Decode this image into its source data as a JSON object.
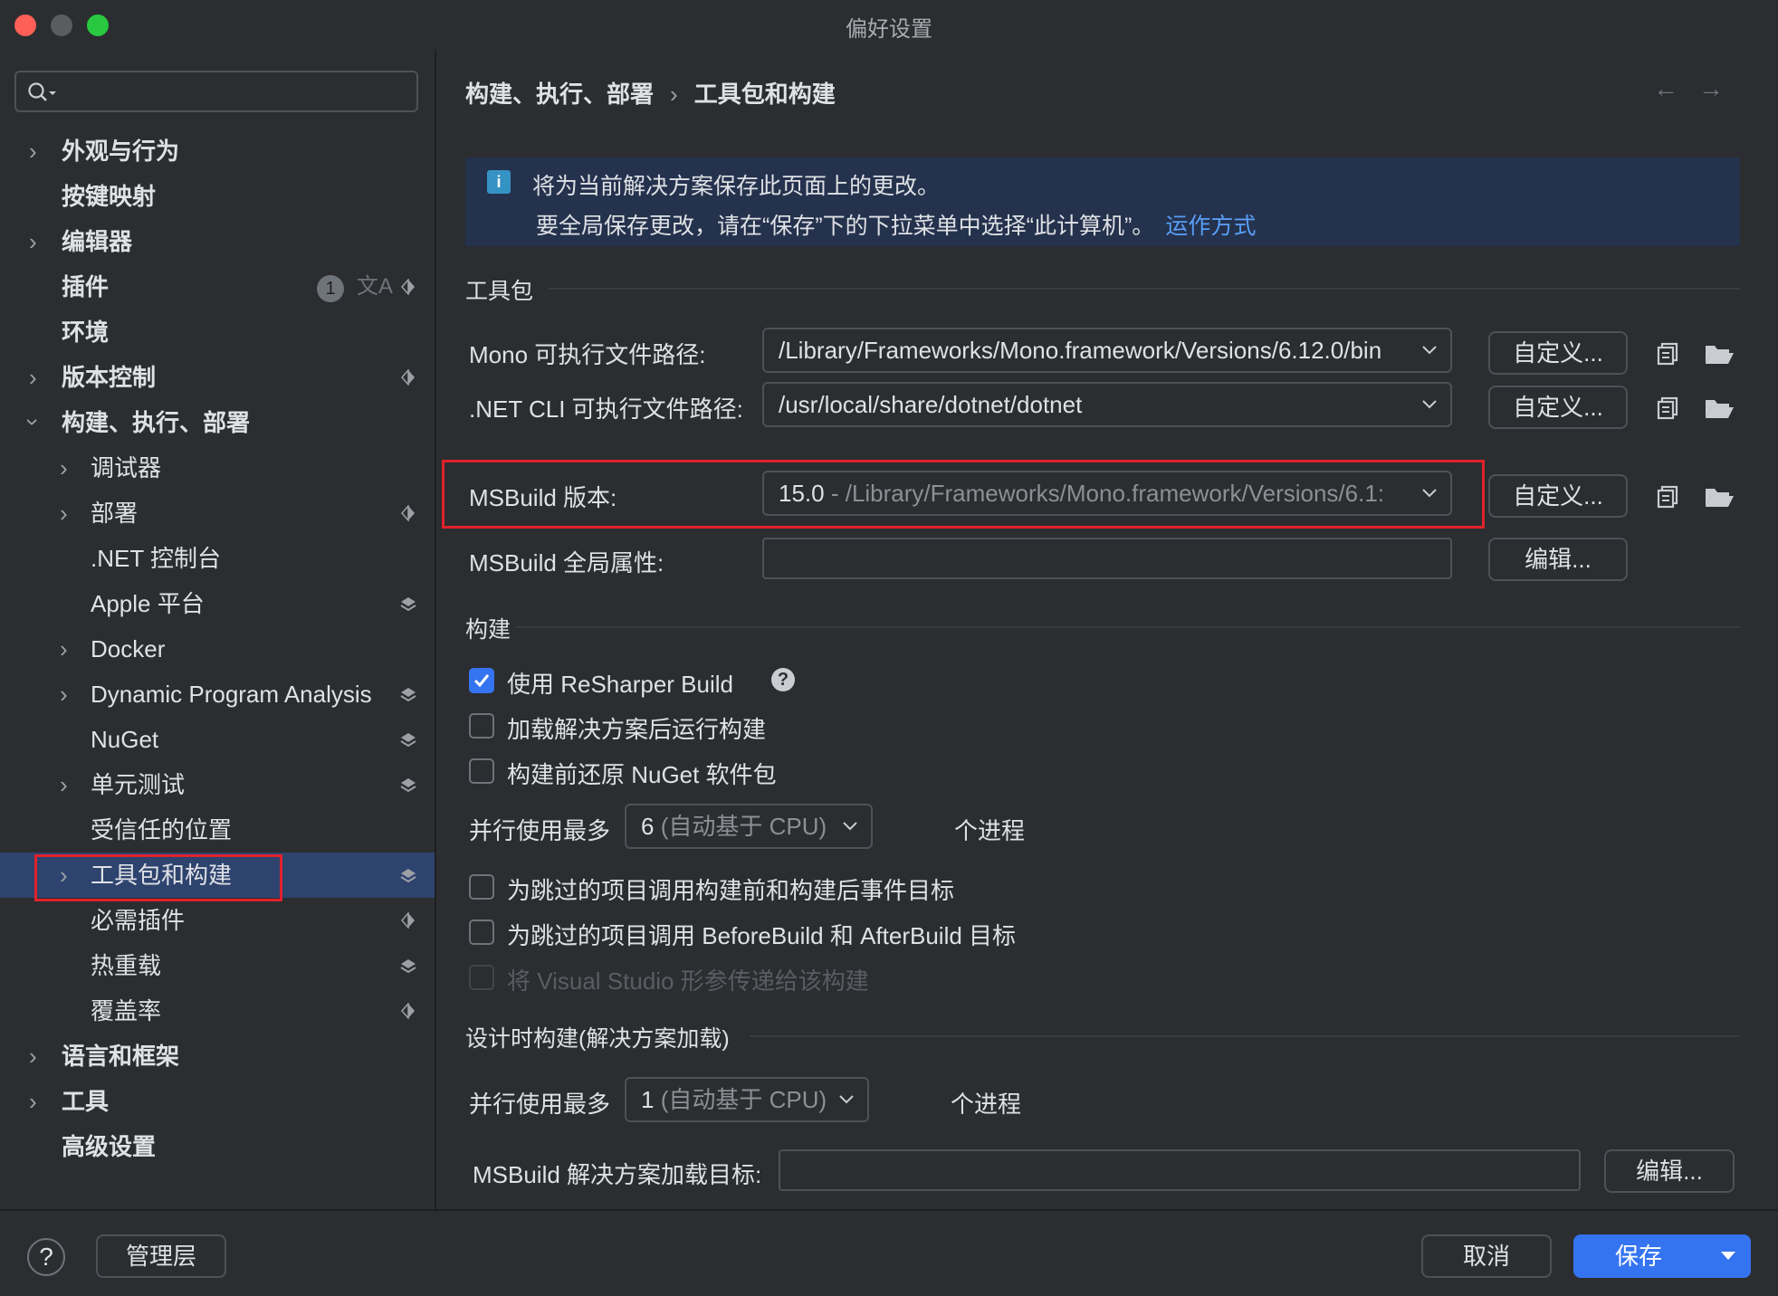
{
  "window": {
    "title": "偏好设置"
  },
  "search": {
    "placeholder": ""
  },
  "sidebar": {
    "items": [
      {
        "label": "外观与行为",
        "bold": true
      },
      {
        "label": "按键映射",
        "bold": true
      },
      {
        "label": "编辑器",
        "bold": true
      },
      {
        "label": "插件",
        "bold": true,
        "badge": "1"
      },
      {
        "label": "环境",
        "bold": true
      },
      {
        "label": "版本控制",
        "bold": true
      },
      {
        "label": "构建、执行、部署",
        "bold": true
      },
      {
        "label": "调试器"
      },
      {
        "label": "部署"
      },
      {
        "label": ".NET 控制台"
      },
      {
        "label": "Apple 平台"
      },
      {
        "label": "Docker"
      },
      {
        "label": "Dynamic Program Analysis"
      },
      {
        "label": "NuGet"
      },
      {
        "label": "单元测试"
      },
      {
        "label": "受信任的位置"
      },
      {
        "label": "工具包和构建",
        "selected": true
      },
      {
        "label": "必需插件"
      },
      {
        "label": "热重载"
      },
      {
        "label": "覆盖率"
      },
      {
        "label": "语言和框架",
        "bold": true
      },
      {
        "label": "工具",
        "bold": true
      },
      {
        "label": "高级设置",
        "bold": true
      }
    ]
  },
  "breadcrumb": {
    "parent": "构建、执行、部署",
    "current": "工具包和构建"
  },
  "nav": {
    "back": "←",
    "forward": "→"
  },
  "info": {
    "line1": "将为当前解决方案保存此页面上的更改。",
    "line2": "要全局保存更改，请在“保存”下的下拉菜单中选择“此计算机”。",
    "link": "运作方式"
  },
  "toolset": {
    "section": "工具包",
    "mono_label": "Mono 可执行文件路径:",
    "mono_value": "/Library/Frameworks/Mono.framework/Versions/6.12.0/bin",
    "dotnet_label": ".NET CLI 可执行文件路径:",
    "dotnet_value": "/usr/local/share/dotnet/dotnet",
    "msbuild_label": "MSBuild 版本:",
    "msbuild_version": "15.0",
    "msbuild_path": " - /Library/Frameworks/Mono.framework/Versions/6.1:",
    "global_props_label": "MSBuild 全局属性:",
    "custom_btn": "自定义...",
    "edit_btn": "编辑..."
  },
  "build": {
    "section": "构建",
    "use_resharper": "使用 ReSharper Build",
    "run_after_load": "加载解决方案后运行构建",
    "restore_nuget": "构建前还原 NuGet 软件包",
    "parallel_label": "并行使用最多",
    "parallel_value": "6",
    "parallel_hint": " (自动基于 CPU)",
    "process_suffix": "个进程",
    "skip_events": "为跳过的项目调用构建前和构建后事件目标",
    "skip_targets": "为跳过的项目调用 BeforeBuild 和 AfterBuild 目标",
    "pass_vs_params": "将 Visual Studio 形参传递给该构建"
  },
  "design_build": {
    "section": "设计时构建(解决方案加载)",
    "parallel_label": "并行使用最多",
    "parallel_value": "1",
    "parallel_hint": " (自动基于 CPU)",
    "process_suffix": "个进程",
    "load_targets_label": "MSBuild 解决方案加载目标:",
    "edit_btn": "编辑..."
  },
  "footer": {
    "help": "?",
    "admin": "管理层",
    "cancel": "取消",
    "save": "保存"
  },
  "colors": {
    "accent": "#3574f0",
    "selection": "#2e436e",
    "highlight_box": "#e0222b",
    "link": "#589df6"
  }
}
